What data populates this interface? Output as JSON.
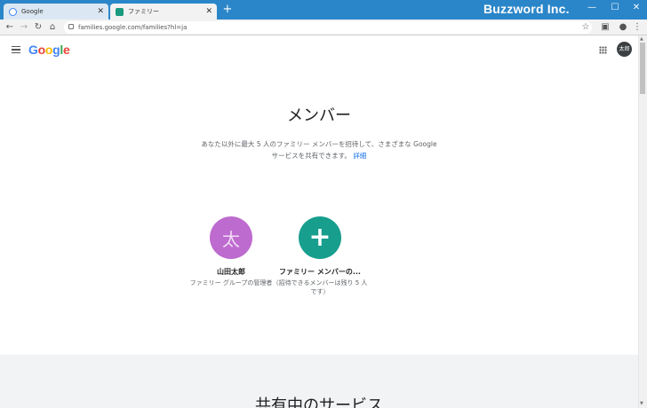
{
  "browser": {
    "tabs": [
      {
        "title": "Google",
        "close": "✕"
      },
      {
        "title": "ファミリー",
        "close": "✕"
      }
    ],
    "new_tab": "+",
    "brand_watermark": "Buzzword Inc.",
    "window_controls": [
      "—",
      "☐",
      "✕"
    ],
    "address": "families.google.com/families?hl=ja"
  },
  "header": {
    "logo_letters": [
      {
        "ch": "G",
        "color": "#4285f4"
      },
      {
        "ch": "o",
        "color": "#ea4335"
      },
      {
        "ch": "o",
        "color": "#fbbc05"
      },
      {
        "ch": "g",
        "color": "#4285f4"
      },
      {
        "ch": "l",
        "color": "#34a853"
      },
      {
        "ch": "e",
        "color": "#ea4335"
      }
    ],
    "avatar_label": "太郎"
  },
  "main": {
    "title": "メンバー",
    "description_line1": "あなた以外に最大 5 人のファミリー メンバーを招待して、さまざまな Google",
    "description_line2": "サービスを共有できます。",
    "details_link": "詳細",
    "members": [
      {
        "initial": "太",
        "name": "山田太郎",
        "role": "ファミリー グループの管理者"
      },
      {
        "initial": "+",
        "name": "ファミリー メンバーの...",
        "role": "（招待できるメンバーは残り 5 人です）"
      }
    ]
  },
  "lower_section": {
    "title": "共有中のサービス"
  },
  "colors": {
    "titlebar": "#2b86c9",
    "member_purple": "#bd6bcf",
    "member_teal": "#179e8d",
    "link": "#1a73e8"
  }
}
